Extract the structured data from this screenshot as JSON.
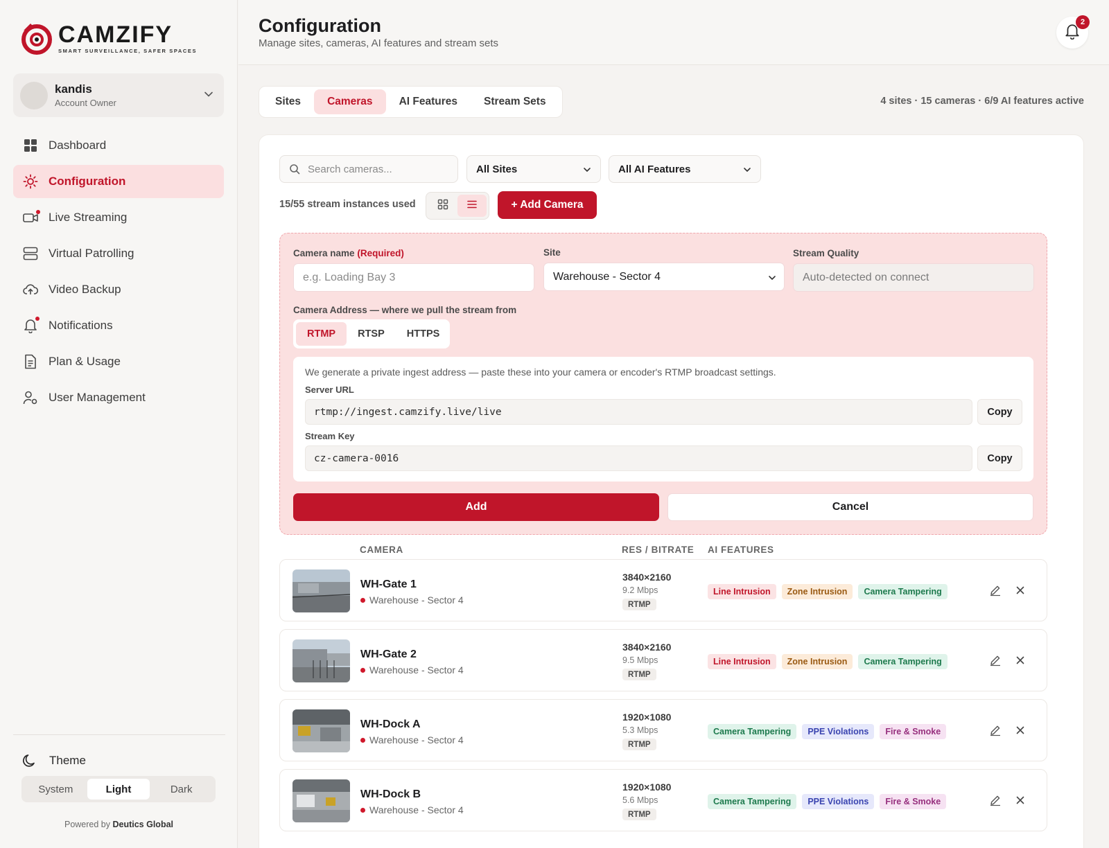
{
  "brand": {
    "name": "CAMZIFY",
    "tagline": "SMART SURVEILLANCE, SAFER SPACES",
    "accent": "#c0152a"
  },
  "user": {
    "name": "kandis",
    "role": "Account Owner"
  },
  "nav": [
    {
      "label": "Dashboard",
      "icon": "dashboard-icon"
    },
    {
      "label": "Configuration",
      "icon": "gear-icon",
      "active": true
    },
    {
      "label": "Live Streaming",
      "icon": "video-icon"
    },
    {
      "label": "Virtual Patrolling",
      "icon": "server-icon"
    },
    {
      "label": "Video Backup",
      "icon": "cloud-upload-icon"
    },
    {
      "label": "Notifications",
      "icon": "bell-icon"
    },
    {
      "label": "Plan & Usage",
      "icon": "document-icon"
    },
    {
      "label": "User Management",
      "icon": "user-gear-icon"
    }
  ],
  "theme": {
    "label": "Theme",
    "options": [
      "System",
      "Light",
      "Dark"
    ],
    "selected": "Light"
  },
  "footer": {
    "powered_prefix": "Powered by",
    "powered_by": "Deutics Global"
  },
  "header": {
    "title": "Configuration",
    "subtitle": "Manage sites, cameras, AI features and stream sets",
    "notification_count": "2"
  },
  "tabs": [
    "Sites",
    "Cameras",
    "AI Features",
    "Stream Sets"
  ],
  "active_tab": "Cameras",
  "stats": "4 sites · 15 cameras · 6/9 AI features active",
  "toolbar": {
    "search_placeholder": "Search cameras...",
    "site_filter": "All Sites",
    "feature_filter": "All AI Features",
    "usage": "15/55 stream instances used",
    "add_camera": "+ Add Camera"
  },
  "form": {
    "name_label": "Camera name",
    "name_required": "(Required)",
    "name_placeholder": "e.g. Loading Bay 3",
    "site_label": "Site",
    "site_value": "Warehouse - Sector 4",
    "quality_label": "Stream Quality",
    "quality_value": "Auto-detected on connect",
    "address_label": "Camera Address — where we pull the stream from",
    "protocols": [
      "RTMP",
      "RTSP",
      "HTTPS"
    ],
    "protocol_selected": "RTMP",
    "ingest_note": "We generate a private ingest address — paste these into your camera or encoder's RTMP broadcast settings.",
    "server_url_label": "Server URL",
    "server_url": "rtmp://ingest.camzify.live/live",
    "stream_key_label": "Stream Key",
    "stream_key": "cz-camera-0016",
    "copy_label": "Copy",
    "add_label": "Add",
    "cancel_label": "Cancel"
  },
  "table": {
    "headers": {
      "camera": "CAMERA",
      "res": "RES / BITRATE",
      "features": "AI FEATURES"
    },
    "rows": [
      {
        "name": "WH-Gate 1",
        "site": "Warehouse - Sector 4",
        "res": "3840×2160",
        "bitrate": "9.2 Mbps",
        "protocol": "RTMP",
        "features": [
          {
            "label": "Line Intrusion",
            "kind": "line"
          },
          {
            "label": "Zone Intrusion",
            "kind": "zone"
          },
          {
            "label": "Camera Tampering",
            "kind": "tamp"
          }
        ]
      },
      {
        "name": "WH-Gate 2",
        "site": "Warehouse - Sector 4",
        "res": "3840×2160",
        "bitrate": "9.5 Mbps",
        "protocol": "RTMP",
        "features": [
          {
            "label": "Line Intrusion",
            "kind": "line"
          },
          {
            "label": "Zone Intrusion",
            "kind": "zone"
          },
          {
            "label": "Camera Tampering",
            "kind": "tamp"
          }
        ]
      },
      {
        "name": "WH-Dock A",
        "site": "Warehouse - Sector 4",
        "res": "1920×1080",
        "bitrate": "5.3 Mbps",
        "protocol": "RTMP",
        "features": [
          {
            "label": "Camera Tampering",
            "kind": "tamp"
          },
          {
            "label": "PPE Violations",
            "kind": "ppe"
          },
          {
            "label": "Fire & Smoke",
            "kind": "fire"
          }
        ]
      },
      {
        "name": "WH-Dock B",
        "site": "Warehouse - Sector 4",
        "res": "1920×1080",
        "bitrate": "5.6 Mbps",
        "protocol": "RTMP",
        "features": [
          {
            "label": "Camera Tampering",
            "kind": "tamp"
          },
          {
            "label": "PPE Violations",
            "kind": "ppe"
          },
          {
            "label": "Fire & Smoke",
            "kind": "fire"
          }
        ]
      }
    ]
  }
}
